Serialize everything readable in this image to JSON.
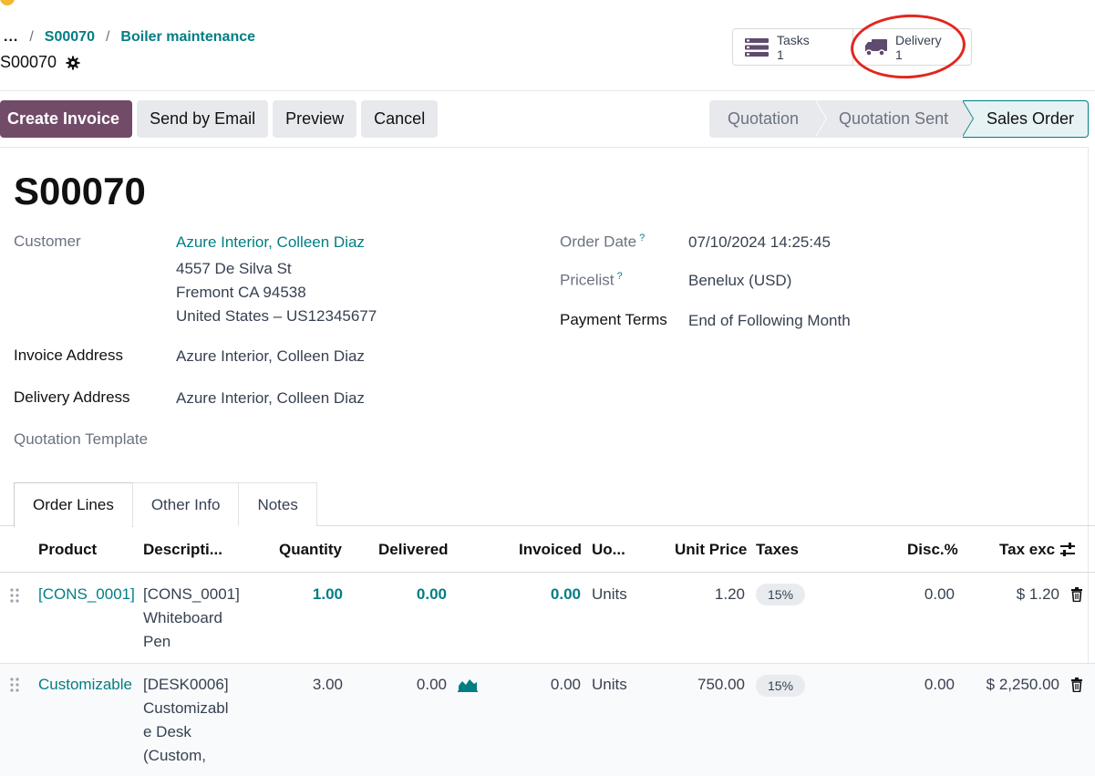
{
  "breadcrumb": {
    "dots": "...",
    "sep": "/",
    "items": [
      "S00070",
      "Boiler maintenance"
    ],
    "record": "S00070"
  },
  "smart_buttons": [
    {
      "label": "Tasks",
      "count": "1",
      "icon": "tasks-icon"
    },
    {
      "label": "Delivery",
      "count": "1",
      "icon": "truck-icon"
    }
  ],
  "actions": {
    "create_invoice": "Create Invoice",
    "send_email": "Send by Email",
    "preview": "Preview",
    "cancel": "Cancel"
  },
  "status": {
    "stages": [
      "Quotation",
      "Quotation Sent",
      "Sales Order"
    ],
    "current": "Sales Order"
  },
  "order": {
    "name": "S00070",
    "customer_label": "Customer",
    "customer_name": "Azure Interior, Colleen Diaz",
    "address_line1": "4557 De Silva St",
    "address_line2": "Fremont CA 94538",
    "address_line3": "United States – US12345677",
    "invoice_address_label": "Invoice Address",
    "invoice_address": "Azure Interior, Colleen Diaz",
    "delivery_address_label": "Delivery Address",
    "delivery_address": "Azure Interior, Colleen Diaz",
    "quotation_template_label": "Quotation Template",
    "order_date_label": "Order Date",
    "order_date": "07/10/2024 14:25:45",
    "pricelist_label": "Pricelist",
    "pricelist": "Benelux (USD)",
    "payment_terms_label": "Payment Terms",
    "payment_terms": "End of Following Month",
    "help_mark": "?"
  },
  "tabs": [
    "Order Lines",
    "Other Info",
    "Notes"
  ],
  "table": {
    "columns": [
      "Product",
      "Descripti...",
      "Quantity",
      "Delivered",
      "Invoiced",
      "Uo...",
      "Unit Price",
      "Taxes",
      "Disc.%",
      "Tax exc"
    ],
    "rows": [
      {
        "product": "[CONS_0001] '",
        "desc1": "[CONS_0001]",
        "desc2": "Whiteboard",
        "desc3": "Pen",
        "quantity": "1.00",
        "delivered": "0.00",
        "invoiced": "0.00",
        "uom": "Units",
        "unit_price": "1.20",
        "tax": "15%",
        "discount": "0.00",
        "subtotal": "$ 1.20"
      },
      {
        "product": "Customizable",
        "desc1": "[DESK0006]",
        "desc2": "Customizabl",
        "desc3": "e Desk",
        "desc4": "(Custom,",
        "quantity": "3.00",
        "delivered": "0.00",
        "invoiced": "0.00",
        "uom": "Units",
        "unit_price": "750.00",
        "tax": "15%",
        "discount": "0.00",
        "subtotal": "$ 2,250.00"
      }
    ]
  },
  "colors": {
    "primary": "#714b67",
    "link": "#017e84",
    "annotation": "#e3261c"
  }
}
